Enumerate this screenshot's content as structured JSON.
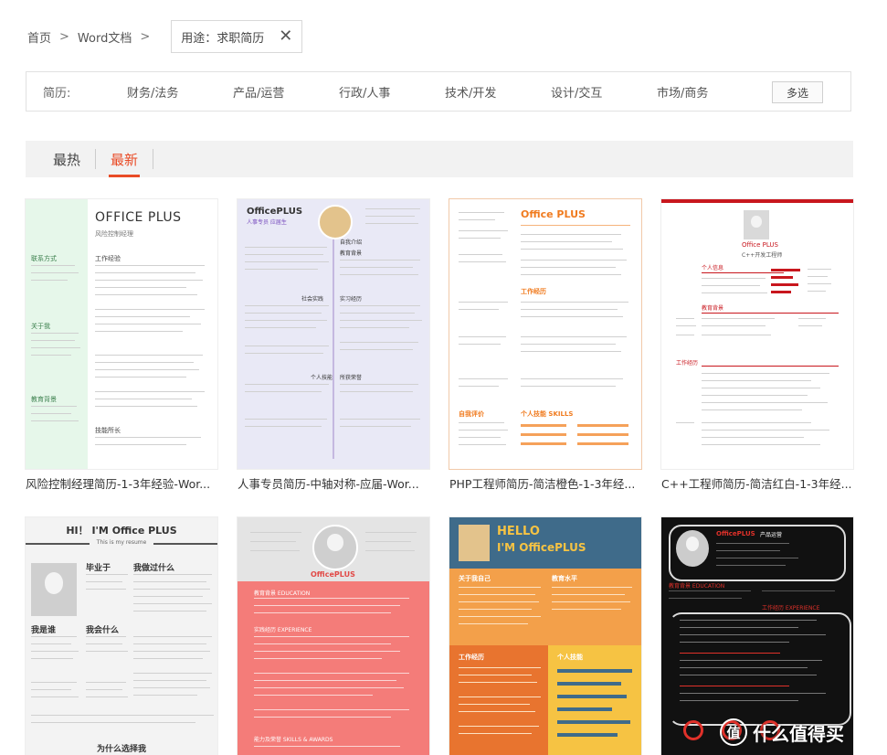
{
  "breadcrumb": {
    "home": "首页",
    "sep": ">",
    "category": "Word文档"
  },
  "active_tag": {
    "label": "用途：求职简历",
    "close": "✕"
  },
  "filter": {
    "label": "简历:",
    "options": [
      "财务/法务",
      "产品/运营",
      "行政/人事",
      "技术/开发",
      "设计/交互",
      "市场/商务"
    ],
    "multi": "多选"
  },
  "sort": {
    "tabs": [
      "最热",
      "最新"
    ],
    "active": "最新"
  },
  "cards": [
    {
      "caption": "风险控制经理简历-1-3年经验-Wor...",
      "thumb": {
        "title": "OFFICE PLUS",
        "subtitle": "风险控制经理",
        "sections": [
          "联系方式",
          "工作经验",
          "关于我",
          "教育背景",
          "技能所长"
        ]
      }
    },
    {
      "caption": "人事专员简历-中轴对称-应届-Wor...",
      "thumb": {
        "title": "OfficePLUS",
        "subtitle": "人事专员 应届生",
        "sections": [
          "自我介绍",
          "教育背景",
          "社会实践",
          "实习经历",
          "个人技能",
          "所获荣誉"
        ]
      }
    },
    {
      "caption": "PHP工程师简历-简洁橙色-1-3年经...",
      "thumb": {
        "title": "Office PLUS",
        "sections": [
          "工作经历",
          "自我评价",
          "个人技能 SKILLS"
        ]
      }
    },
    {
      "caption": "C++工程师简历-简洁红白-1-3年经...",
      "thumb": {
        "title": "Office PLUS",
        "subtitle": "C++开发工程师",
        "sections": [
          "个人信息",
          "教育背景",
          "工作经历"
        ]
      }
    },
    {
      "caption": "",
      "thumb": {
        "title": "HI！ I'M Office PLUS",
        "subtitle": "This is my resume",
        "sections": [
          "毕业于",
          "我做过什么",
          "我是谁",
          "我会什么",
          "为什么选择我"
        ]
      }
    },
    {
      "caption": "",
      "thumb": {
        "title": "OfficePLUS",
        "sections": [
          "教育背景 EDUCATION",
          "实践经历 EXPERIENCE",
          "能力及荣誉 SKILLS & AWARDS"
        ]
      }
    },
    {
      "caption": "",
      "thumb": {
        "title": "HELLO",
        "subtitle": "I'M OfficePLUS",
        "sections": [
          "关于我自己",
          "教育水平",
          "工作经历",
          "个人技能"
        ]
      }
    },
    {
      "caption": "",
      "thumb": {
        "title": "OfficePLUS",
        "subtitle": "产品运营",
        "sections": [
          "教育背景 EDUCATION",
          "工作经历 EXPERIENCE"
        ]
      }
    }
  ],
  "watermark": {
    "glyph": "值",
    "text": "什么值得买"
  }
}
